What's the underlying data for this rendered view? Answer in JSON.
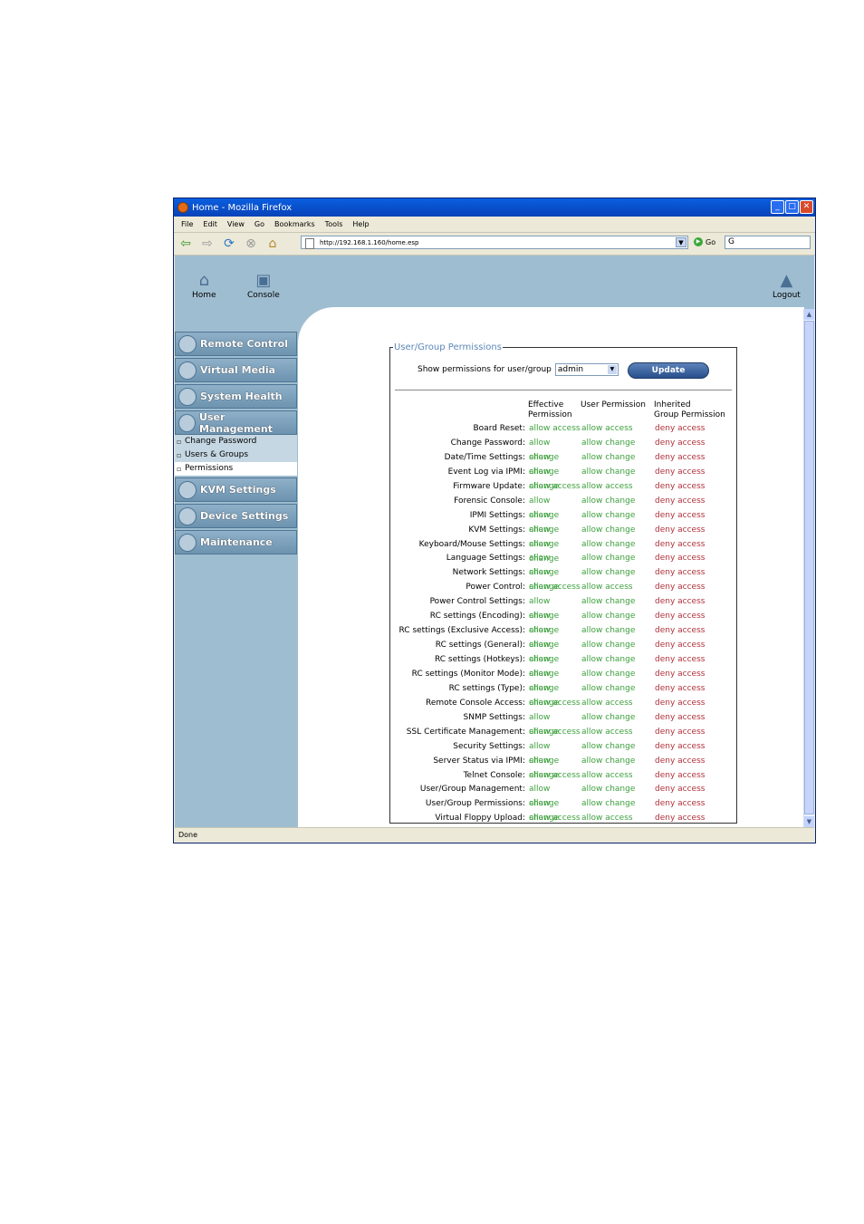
{
  "window": {
    "title": "Home - Mozilla Firefox"
  },
  "menu": [
    "File",
    "Edit",
    "View",
    "Go",
    "Bookmarks",
    "Tools",
    "Help"
  ],
  "toolbar": {
    "url": "http://192.168.1.160/home.esp",
    "go_label": "Go",
    "search_value": "G"
  },
  "top_icons": {
    "home": "Home",
    "console": "Console",
    "logout": "Logout"
  },
  "sidebar": {
    "items": [
      "Remote Control",
      "Virtual Media",
      "System Health",
      "User Management"
    ],
    "submenu": [
      "Change Password",
      "Users & Groups",
      "Permissions"
    ],
    "items_after": [
      "KVM Settings",
      "Device Settings",
      "Maintenance"
    ]
  },
  "panel": {
    "legend": "User/Group Permissions",
    "show_label": "Show permissions for user/group",
    "selected_user": "admin",
    "update_label": "Update",
    "col_effective": "Effective Permission",
    "col_effective_1": "Effective",
    "col_effective_2": "Permission",
    "col_user": "User Permission",
    "col_inherited_1": "Inherited",
    "col_inherited_2": "Group Permission",
    "rows": [
      [
        "Board Reset:",
        "allow access",
        "allow access",
        "deny access"
      ],
      [
        "Change Password:",
        "allow change",
        "allow change",
        "deny access"
      ],
      [
        "Date/Time Settings:",
        "allow change",
        "allow change",
        "deny access"
      ],
      [
        "Event Log via IPMI:",
        "allow change",
        "allow change",
        "deny access"
      ],
      [
        "Firmware Update:",
        "allow access",
        "allow access",
        "deny access"
      ],
      [
        "Forensic Console:",
        "allow change",
        "allow change",
        "deny access"
      ],
      [
        "IPMI Settings:",
        "allow change",
        "allow change",
        "deny access"
      ],
      [
        "KVM Settings:",
        "allow change",
        "allow change",
        "deny access"
      ],
      [
        "Keyboard/Mouse Settings:",
        "allow change",
        "allow change",
        "deny access"
      ],
      [
        "Language Settings:",
        "allow change",
        "allow change",
        "deny access"
      ],
      [
        "Network Settings:",
        "allow change",
        "allow change",
        "deny access"
      ],
      [
        "Power Control:",
        "allow access",
        "allow access",
        "deny access"
      ],
      [
        "Power Control Settings:",
        "allow change",
        "allow change",
        "deny access"
      ],
      [
        "RC settings (Encoding):",
        "allow change",
        "allow change",
        "deny access"
      ],
      [
        "RC settings (Exclusive Access):",
        "allow change",
        "allow change",
        "deny access"
      ],
      [
        "RC settings (General):",
        "allow change",
        "allow change",
        "deny access"
      ],
      [
        "RC settings (Hotkeys):",
        "allow change",
        "allow change",
        "deny access"
      ],
      [
        "RC settings (Monitor Mode):",
        "allow change",
        "allow change",
        "deny access"
      ],
      [
        "RC settings (Type):",
        "allow change",
        "allow change",
        "deny access"
      ],
      [
        "Remote Console Access:",
        "allow access",
        "allow access",
        "deny access"
      ],
      [
        "SNMP Settings:",
        "allow change",
        "allow change",
        "deny access"
      ],
      [
        "SSL Certificate Management:",
        "allow access",
        "allow access",
        "deny access"
      ],
      [
        "Security Settings:",
        "allow change",
        "allow change",
        "deny access"
      ],
      [
        "Server Status via IPMI:",
        "allow change",
        "allow change",
        "deny access"
      ],
      [
        "Telnet Console:",
        "allow access",
        "allow access",
        "deny access"
      ],
      [
        "User/Group Management:",
        "allow change",
        "allow change",
        "deny access"
      ],
      [
        "User/Group Permissions:",
        "allow change",
        "allow change",
        "deny access"
      ],
      [
        "Virtual Floppy Upload:",
        "allow access",
        "allow access",
        "deny access"
      ]
    ]
  },
  "status_text": "Done",
  "colors": {
    "allow": "#3da03d",
    "deny": "#b0303a",
    "legend": "#5b87b8",
    "sidebar_bg": "#9fbdd0"
  }
}
